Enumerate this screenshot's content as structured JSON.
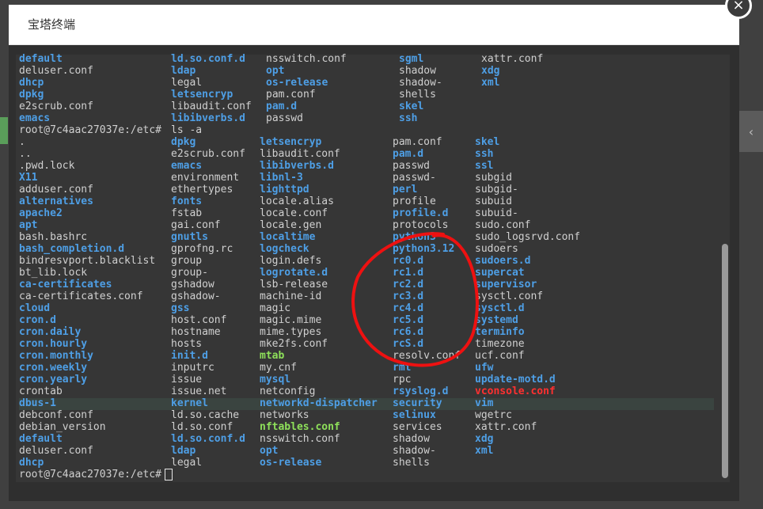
{
  "window": {
    "title": "宝塔终端",
    "close_icon": "×"
  },
  "background": {
    "right_chevron": "‹"
  },
  "terminal": {
    "prompt": "root@7c4aac27037e:/etc#",
    "command": "ls -a",
    "colors": {
      "plain": "#d0d0d0",
      "dir": "#4e9fe6",
      "green": "#8ee05a",
      "red": "#ff3030"
    },
    "scroll_fraction": 1.0,
    "top_rows": [
      [
        [
          "default",
          "d"
        ],
        [
          "ld.so.conf.d",
          "d"
        ],
        [
          "nsswitch.conf",
          "p"
        ],
        [
          "sgml",
          "d"
        ],
        [
          "xattr.conf",
          "p"
        ]
      ],
      [
        [
          "deluser.conf",
          "p"
        ],
        [
          "ldap",
          "d"
        ],
        [
          "opt",
          "d"
        ],
        [
          "shadow",
          "p"
        ],
        [
          "xdg",
          "d"
        ]
      ],
      [
        [
          "dhcp",
          "d"
        ],
        [
          "legal",
          "p"
        ],
        [
          "os-release",
          "d"
        ],
        [
          "shadow-",
          "p"
        ],
        [
          "xml",
          "d"
        ]
      ],
      [
        [
          "dpkg",
          "d"
        ],
        [
          "letsencryp",
          "d"
        ],
        [
          "pam.conf",
          "p"
        ],
        [
          "shells",
          "p"
        ],
        [
          "",
          ""
        ]
      ],
      [
        [
          "e2scrub.conf",
          "p"
        ],
        [
          "libaudit.conf",
          "p"
        ],
        [
          "pam.d",
          "d"
        ],
        [
          "skel",
          "d"
        ],
        [
          "",
          ""
        ]
      ],
      [
        [
          "emacs",
          "d"
        ],
        [
          "libibverbs.d",
          "d"
        ],
        [
          "passwd",
          "p"
        ],
        [
          "ssh",
          "d"
        ],
        [
          "",
          ""
        ]
      ]
    ],
    "listing": [
      [
        ".",
        "p"
      ],
      [
        "..",
        "p"
      ],
      [
        ".pwd.lock",
        "p"
      ],
      [
        "X11",
        "d"
      ],
      [
        "adduser.conf",
        "p"
      ],
      [
        "alternatives",
        "d"
      ],
      [
        "apache2",
        "d"
      ],
      [
        "apt",
        "d"
      ],
      [
        "bash.bashrc",
        "p"
      ],
      [
        "bash_completion.d",
        "d"
      ],
      [
        "bindresvport.blacklist",
        "p"
      ],
      [
        "bt_lib.lock",
        "p"
      ],
      [
        "ca-certificates",
        "d"
      ],
      [
        "ca-certificates.conf",
        "p"
      ],
      [
        "cloud",
        "d"
      ],
      [
        "cron.d",
        "d"
      ],
      [
        "cron.daily",
        "d"
      ],
      [
        "cron.hourly",
        "d"
      ],
      [
        "cron.monthly",
        "d"
      ],
      [
        "cron.weekly",
        "d"
      ],
      [
        "cron.yearly",
        "d"
      ],
      [
        "crontab",
        "p"
      ],
      [
        "dbus-1",
        "d"
      ],
      [
        "debconf.conf",
        "p"
      ],
      [
        "debian_version",
        "p"
      ],
      [
        "default",
        "d"
      ],
      [
        "deluser.conf",
        "p"
      ],
      [
        "dhcp",
        "d"
      ],
      [
        "dpkg",
        "d"
      ],
      [
        "e2scrub.conf",
        "p"
      ],
      [
        "emacs",
        "d"
      ],
      [
        "environment",
        "p"
      ],
      [
        "ethertypes",
        "p"
      ],
      [
        "fonts",
        "d"
      ],
      [
        "fstab",
        "p"
      ],
      [
        "gai.conf",
        "p"
      ],
      [
        "gnutls",
        "d"
      ],
      [
        "gprofng.rc",
        "p"
      ],
      [
        "group",
        "p"
      ],
      [
        "group-",
        "p"
      ],
      [
        "gshadow",
        "p"
      ],
      [
        "gshadow-",
        "p"
      ],
      [
        "gss",
        "d"
      ],
      [
        "host.conf",
        "p"
      ],
      [
        "hostname",
        "p"
      ],
      [
        "hosts",
        "p"
      ],
      [
        "init.d",
        "d"
      ],
      [
        "inputrc",
        "p"
      ],
      [
        "issue",
        "p"
      ],
      [
        "issue.net",
        "p"
      ],
      [
        "kernel",
        "d"
      ],
      [
        "ld.so.cache",
        "p"
      ],
      [
        "ld.so.conf",
        "p"
      ],
      [
        "ld.so.conf.d",
        "d"
      ],
      [
        "ldap",
        "d"
      ],
      [
        "legal",
        "p"
      ],
      [
        "letsencryp",
        "d"
      ],
      [
        "libaudit.conf",
        "p"
      ],
      [
        "libibverbs.d",
        "d"
      ],
      [
        "libnl-3",
        "d"
      ],
      [
        "lighttpd",
        "d"
      ],
      [
        "locale.alias",
        "p"
      ],
      [
        "locale.conf",
        "p"
      ],
      [
        "locale.gen",
        "p"
      ],
      [
        "localtime",
        "d"
      ],
      [
        "logcheck",
        "d"
      ],
      [
        "login.defs",
        "p"
      ],
      [
        "logrotate.d",
        "d"
      ],
      [
        "lsb-release",
        "p"
      ],
      [
        "machine-id",
        "p"
      ],
      [
        "magic",
        "p"
      ],
      [
        "magic.mime",
        "p"
      ],
      [
        "mime.types",
        "p"
      ],
      [
        "mke2fs.conf",
        "p"
      ],
      [
        "mtab",
        "g"
      ],
      [
        "my.cnf",
        "p"
      ],
      [
        "mysql",
        "d"
      ],
      [
        "netconfig",
        "p"
      ],
      [
        "networkd-dispatcher",
        "d"
      ],
      [
        "networks",
        "p"
      ],
      [
        "nftables.conf",
        "g"
      ],
      [
        "nsswitch.conf",
        "p"
      ],
      [
        "opt",
        "d"
      ],
      [
        "os-release",
        "d"
      ],
      [
        "pam.conf",
        "p"
      ],
      [
        "pam.d",
        "d"
      ],
      [
        "passwd",
        "p"
      ],
      [
        "passwd-",
        "p"
      ],
      [
        "perl",
        "d"
      ],
      [
        "profile",
        "p"
      ],
      [
        "profile.d",
        "d"
      ],
      [
        "protocols",
        "p"
      ],
      [
        "python3",
        "d"
      ],
      [
        "python3.12",
        "d"
      ],
      [
        "rc0.d",
        "d"
      ],
      [
        "rc1.d",
        "d"
      ],
      [
        "rc2.d",
        "d"
      ],
      [
        "rc3.d",
        "d"
      ],
      [
        "rc4.d",
        "d"
      ],
      [
        "rc5.d",
        "d"
      ],
      [
        "rc6.d",
        "d"
      ],
      [
        "rcS.d",
        "d"
      ],
      [
        "resolv.conf",
        "p"
      ],
      [
        "rmt",
        "d"
      ],
      [
        "rpc",
        "p"
      ],
      [
        "rsyslog.d",
        "d"
      ],
      [
        "security",
        "d"
      ],
      [
        "selinux",
        "d"
      ],
      [
        "services",
        "p"
      ],
      [
        "shadow",
        "p"
      ],
      [
        "shadow-",
        "p"
      ],
      [
        "shells",
        "p"
      ],
      [
        "skel",
        "d"
      ],
      [
        "ssh",
        "d"
      ],
      [
        "ssl",
        "d"
      ],
      [
        "subgid",
        "p"
      ],
      [
        "subgid-",
        "p"
      ],
      [
        "subuid",
        "p"
      ],
      [
        "subuid-",
        "p"
      ],
      [
        "sudo.conf",
        "p"
      ],
      [
        "sudo_logsrvd.conf",
        "p"
      ],
      [
        "sudoers",
        "p"
      ],
      [
        "sudoers.d",
        "d"
      ],
      [
        "supercat",
        "d"
      ],
      [
        "supervisor",
        "d"
      ],
      [
        "sysctl.conf",
        "p"
      ],
      [
        "sysctl.d",
        "d"
      ],
      [
        "systemd",
        "d"
      ],
      [
        "terminfo",
        "d"
      ],
      [
        "timezone",
        "p"
      ],
      [
        "ucf.conf",
        "p"
      ],
      [
        "ufw",
        "d"
      ],
      [
        "update-motd.d",
        "d"
      ],
      [
        "vconsole.conf",
        "r"
      ],
      [
        "vim",
        "d"
      ],
      [
        "wgetrc",
        "p"
      ],
      [
        "xattr.conf",
        "p"
      ],
      [
        "xdg",
        "d"
      ],
      [
        "xml",
        "d"
      ]
    ],
    "listing_rows": 28
  }
}
